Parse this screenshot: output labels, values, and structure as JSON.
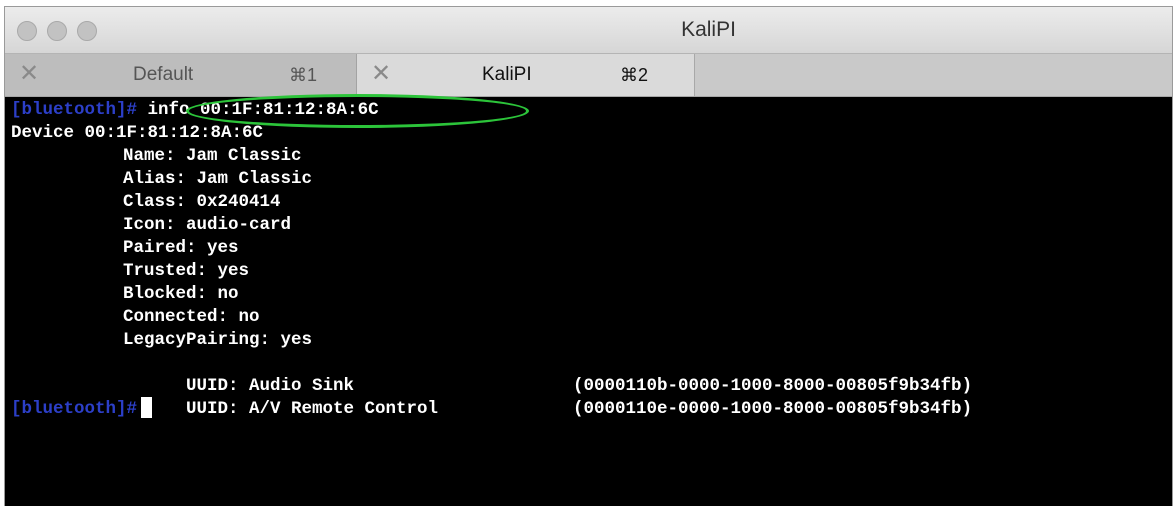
{
  "window": {
    "title": "KaliPI",
    "colors": {
      "prompt": "#2c3fc8",
      "highlight": "#2cc43a",
      "background": "#000000",
      "text": "#ffffff"
    }
  },
  "tabs": [
    {
      "label": "Default",
      "shortcut": "⌘1",
      "close": "✕",
      "active": false
    },
    {
      "label": "KaliPI",
      "shortcut": "⌘2",
      "close": "✕",
      "active": true
    }
  ],
  "terminal": {
    "prompt": "[bluetooth]# ",
    "command": "info 00:1F:81:12:8A:6C",
    "device_line": "Device 00:1F:81:12:8A:6C",
    "properties": [
      "Name: Jam Classic",
      "Alias: Jam Classic",
      "Class: 0x240414",
      "Icon: audio-card",
      "Paired: yes",
      "Trusted: yes",
      "Blocked: no",
      "Connected: no",
      "LegacyPairing: yes"
    ],
    "uuids": [
      {
        "label": "UUID: Audio Sink",
        "value": "(0000110b-0000-1000-8000-00805f9b34fb)"
      },
      {
        "label": "UUID: A/V Remote Control",
        "value": "(0000110e-0000-1000-8000-00805f9b34fb)"
      }
    ],
    "final_prompt": "[bluetooth]#"
  }
}
